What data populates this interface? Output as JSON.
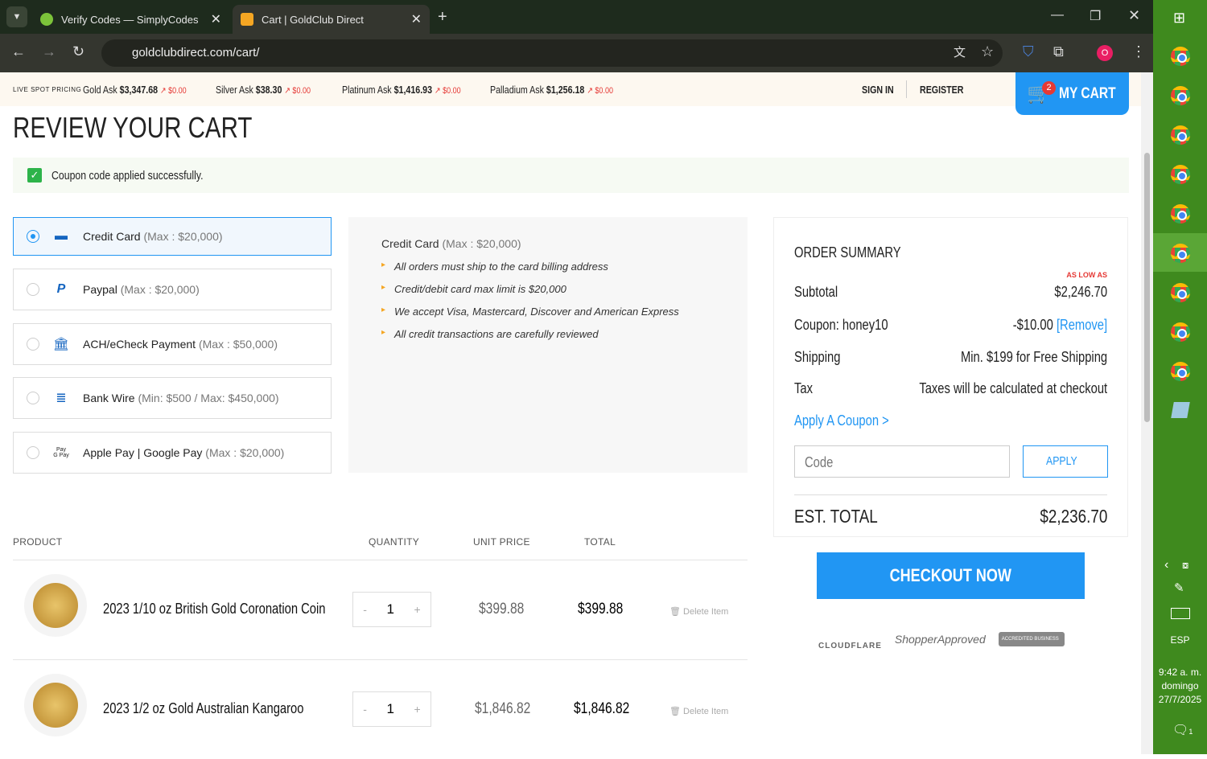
{
  "browser": {
    "tabs": [
      {
        "title": "Verify Codes — SimplyCodes"
      },
      {
        "title": "Cart | GoldClub Direct"
      }
    ],
    "url": "goldclubdirect.com/cart/",
    "profile": "O"
  },
  "ticker": {
    "label": "LIVE SPOT PRICING",
    "items": [
      {
        "name": "Gold Ask",
        "price": "$3,347.68",
        "change": "$0.00"
      },
      {
        "name": "Silver Ask",
        "price": "$38.30",
        "change": "$0.00"
      },
      {
        "name": "Platinum Ask",
        "price": "$1,416.93",
        "change": "$0.00"
      },
      {
        "name": "Palladium Ask",
        "price": "$1,256.18",
        "change": "$0.00"
      }
    ]
  },
  "header": {
    "sign_in": "SIGN IN",
    "register": "REGISTER",
    "cart": "MY CART",
    "cart_count": "2"
  },
  "page": {
    "title": "REVIEW YOUR CART",
    "coupon_msg": "Coupon code applied successfully."
  },
  "payments": [
    {
      "name": "Credit Card",
      "limit": "(Max : $20,000)",
      "selected": true
    },
    {
      "name": "Paypal",
      "limit": "(Max : $20,000)"
    },
    {
      "name": "ACH/eCheck Payment",
      "limit": "(Max : $50,000)"
    },
    {
      "name": "Bank Wire",
      "limit": "(Min: $500 / Max: $450,000)"
    },
    {
      "name": "Apple Pay | Google Pay",
      "limit": "(Max : $20,000)"
    }
  ],
  "info": {
    "name": "Credit Card",
    "limit": "(Max : $20,000)",
    "bullets": [
      "All orders must ship to the card billing address",
      "Credit/debit card max limit is $20,000",
      "We accept Visa, Mastercard, Discover and American Express",
      "All credit transactions are carefully reviewed"
    ]
  },
  "summary": {
    "title": "ORDER SUMMARY",
    "as_low_as": "AS LOW AS",
    "subtotal_label": "Subtotal",
    "subtotal": "$2,246.70",
    "coupon_label": "Coupon: honey10",
    "coupon_value": "-$10.00",
    "remove": "[Remove]",
    "shipping_label": "Shipping",
    "shipping": "Min. $199 for Free Shipping",
    "tax_label": "Tax",
    "tax": "Taxes will be calculated at checkout",
    "apply_coupon": "Apply A Coupon >",
    "code_placeholder": "Code",
    "apply": "APPLY",
    "total_label": "EST. TOTAL",
    "total": "$2,236.70"
  },
  "checkout": "CHECKOUT NOW",
  "badges": {
    "cloudflare": "CLOUDFLARE",
    "shopper": "ShopperApproved",
    "bbb": "ACCREDITED BUSINESS"
  },
  "table": {
    "headers": [
      "PRODUCT",
      "QUANTITY",
      "UNIT PRICE",
      "TOTAL"
    ],
    "delete": "Delete Item",
    "rows": [
      {
        "name": "2023 1/10 oz British Gold Coronation Coin",
        "qty": "1",
        "unit": "$399.88",
        "total": "$399.88"
      },
      {
        "name": "2023 1/2 oz Gold Australian Kangaroo",
        "qty": "1",
        "unit": "$1,846.82",
        "total": "$1,846.82"
      }
    ]
  },
  "taskbar": {
    "lang": "ESP",
    "time": "9:42 a. m.",
    "day": "domingo",
    "date": "27/7/2025",
    "notifications": "1"
  }
}
